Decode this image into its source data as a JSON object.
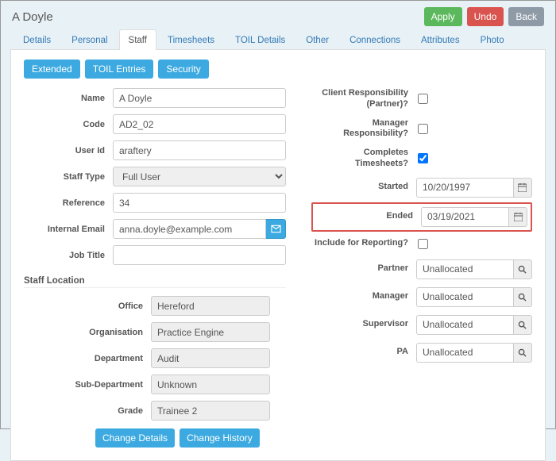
{
  "header": {
    "title": "A Doyle",
    "apply": "Apply",
    "undo": "Undo",
    "back": "Back"
  },
  "tabs": {
    "details": "Details",
    "personal": "Personal",
    "staff": "Staff",
    "timesheets": "Timesheets",
    "toil_details": "TOIL Details",
    "other": "Other",
    "connections": "Connections",
    "attributes": "Attributes",
    "photo": "Photo",
    "active": "staff"
  },
  "sub_tabs": {
    "extended": "Extended",
    "toil_entries": "TOIL Entries",
    "security": "Security"
  },
  "left": {
    "labels": {
      "name": "Name",
      "code": "Code",
      "user_id": "User Id",
      "staff_type": "Staff Type",
      "reference": "Reference",
      "internal_email": "Internal Email",
      "job_title": "Job Title",
      "staff_location": "Staff Location",
      "office": "Office",
      "organisation": "Organisation",
      "department": "Department",
      "sub_department": "Sub-Department",
      "grade": "Grade"
    },
    "values": {
      "name": "A Doyle",
      "code": "AD2_02",
      "user_id": "araftery",
      "staff_type": "Full User",
      "reference": "34",
      "internal_email": "anna.doyle@example.com",
      "job_title": "",
      "office": "Hereford",
      "organisation": "Practice Engine",
      "department": "Audit",
      "sub_department": "Unknown",
      "grade": "Trainee 2"
    },
    "actions": {
      "change_details": "Change Details",
      "change_history": "Change History"
    }
  },
  "right": {
    "labels": {
      "client_resp": "Client Responsibility (Partner)?",
      "manager_resp": "Manager Responsibility?",
      "completes_ts": "Completes Timesheets?",
      "started": "Started",
      "ended": "Ended",
      "include_reporting": "Include for Reporting?",
      "partner": "Partner",
      "manager": "Manager",
      "supervisor": "Supervisor",
      "pa": "PA"
    },
    "values": {
      "client_resp": false,
      "manager_resp": false,
      "completes_ts": true,
      "started": "10/20/1997",
      "ended": "03/19/2021",
      "include_reporting": false,
      "partner": "Unallocated",
      "manager": "Unallocated",
      "supervisor": "Unallocated",
      "pa": "Unallocated"
    },
    "highlight_field": "ended"
  }
}
